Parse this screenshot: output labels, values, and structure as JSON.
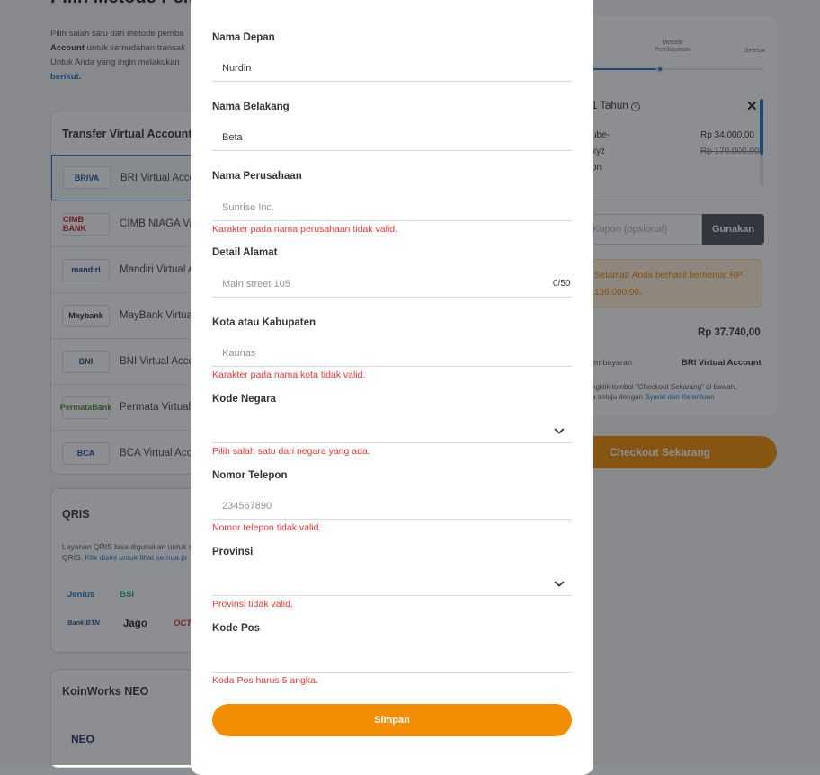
{
  "page": {
    "title": "Pilih Metode Pemba",
    "desc_pre": "Pilih salah satu dari metode pemba",
    "desc_bold": "Account",
    "desc_mid": " untuk kemudahan transak",
    "desc_line3": "Untuk Anda yang ingin melakukan",
    "desc_link": "berikut."
  },
  "va": {
    "title": "Transfer Virtual Account (",
    "banks": [
      {
        "logo": "BRIVA",
        "name": "BRI Virtual Acco",
        "color": "#1a4f9c"
      },
      {
        "logo": "CIMB BANK",
        "name": "CIMB NIAGA Vi",
        "color": "#c21d1d"
      },
      {
        "logo": "mandiri",
        "name": "Mandiri Virtual A",
        "color": "#1b3f7a"
      },
      {
        "logo": "Maybank",
        "name": "MayBank Virtual",
        "color": "#222"
      },
      {
        "logo": "BNI",
        "name": "BNI Virtual Acco",
        "color": "#1a4f7a"
      },
      {
        "logo": "PermataBank",
        "name": "Permata Virtual",
        "color": "#4b8b2a"
      },
      {
        "logo": "BCA",
        "name": "BCA Virtual Acc",
        "color": "#1b4ea1"
      }
    ]
  },
  "qris": {
    "title": "QRIS",
    "text": "Layanan QRIS bisa digunakan untuk s",
    "text2": "QRIS. ",
    "link": "Klik disini untuk lihat semua pi",
    "logos": [
      "Jenius",
      "BSI",
      "Bank BTN",
      "Jago",
      "OCTO"
    ]
  },
  "koin": {
    "title": "KoinWorks NEO",
    "logo": "NEO"
  },
  "summary": {
    "step_label": "Metode Pembayaran",
    "step_done": "Selesai",
    "plan": "1 Tahun",
    "item1": "ube-",
    "item1_price": "Rp 34.000,00",
    "item2": "xyz",
    "item2_price": "Rp 170.000,00",
    "item3": "on",
    "coupon_placeholder": "Kupon (opsional)",
    "coupon_button": "Gunakan",
    "promo_line1": "Selamat! Anda berhasil berhemat RP",
    "promo_line2": "136.000,00.",
    "total": "Rp 37.740,00",
    "method_label": "embayaran",
    "method_value": "BRI Virtual Account",
    "terms_line1": "ngklik tombol \"Checkout Sekarang\" di bawah,",
    "terms_line2": "a setuju dengan ",
    "terms_link": "Syarat dan Ketentuan",
    "checkout": "Checkout Sekarang"
  },
  "form": {
    "first_name": {
      "label": "Nama Depan",
      "value": "Nurdin"
    },
    "last_name": {
      "label": "Nama Belakang",
      "value": "Beta"
    },
    "company": {
      "label": "Nama Perusahaan",
      "placeholder": "Sunrise Inc.",
      "error": "Karakter pada nama perusahaan tidak valid."
    },
    "address": {
      "label": "Detail Alamat",
      "placeholder": "Main street 105",
      "counter": "0/50"
    },
    "city": {
      "label": "Kota atau Kabupaten",
      "placeholder": "Kaunas",
      "error": "Karakter pada nama kota tidak valid."
    },
    "country": {
      "label": "Kode Negara",
      "error": "Pilih salah satu dari negara yang ada."
    },
    "phone": {
      "label": "Nomor Telepon",
      "placeholder": "234567890",
      "error": "Nomor telepon tidak valid."
    },
    "province": {
      "label": "Provinsi",
      "error": "Provinsi tidak valid."
    },
    "postal": {
      "label": "Kode Pos",
      "error": "Koda Pos harus 5 angka."
    },
    "submit": "Simpan"
  },
  "colors": {
    "accent": "#f28c00",
    "error": "#e53935",
    "link": "#1a72c7"
  }
}
